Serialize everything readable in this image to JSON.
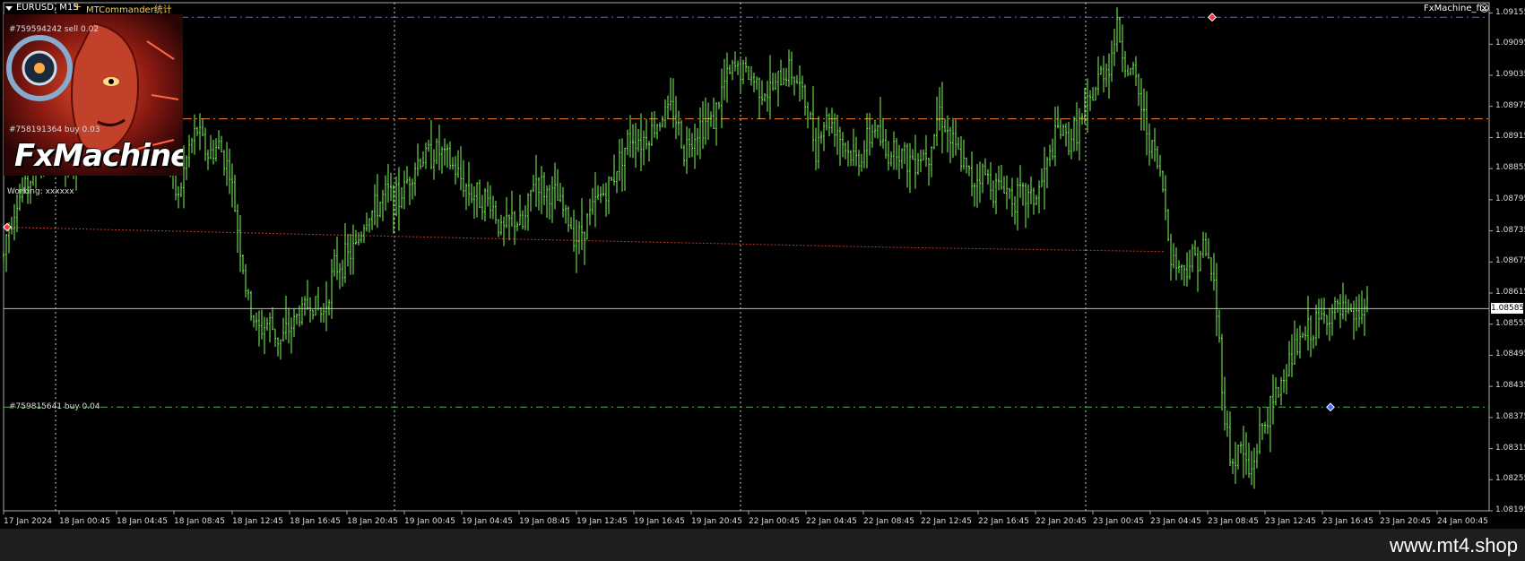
{
  "header": {
    "symbol": "EURUSD, M15",
    "plus": "+",
    "indicator": "MTCommander统计",
    "ea_name": "FxMachine_fix"
  },
  "logo": {
    "text": "FxMachine",
    "icon": "robot-head-logo"
  },
  "status": {
    "working": "Working: xxxxxx"
  },
  "orders": [
    {
      "label": "#759594242 sell 0.02",
      "price": 1.09147,
      "color": "#3f6fff"
    },
    {
      "label": "#758191364 buy 0.03",
      "price": 1.08951,
      "color": "#ff7f27"
    },
    {
      "label": "#759815641 buy 0.04",
      "price": 1.08395,
      "color": "#4caf50"
    }
  ],
  "price_axis": [
    "1.09155",
    "1.09095",
    "1.09035",
    "1.08975",
    "1.08915",
    "1.08855",
    "1.08795",
    "1.08735",
    "1.08675",
    "1.08615",
    "1.08555",
    "1.08495",
    "1.08435",
    "1.08375",
    "1.08315",
    "1.08255",
    "1.08195"
  ],
  "current_price": "1.08585",
  "time_axis": [
    "17 Jan 2024",
    "18 Jan 00:45",
    "18 Jan 04:45",
    "18 Jan 08:45",
    "18 Jan 12:45",
    "18 Jan 16:45",
    "18 Jan 20:45",
    "19 Jan 00:45",
    "19 Jan 04:45",
    "19 Jan 08:45",
    "19 Jan 12:45",
    "19 Jan 16:45",
    "19 Jan 20:45",
    "22 Jan 00:45",
    "22 Jan 04:45",
    "22 Jan 08:45",
    "22 Jan 12:45",
    "22 Jan 16:45",
    "22 Jan 20:45",
    "23 Jan 00:45",
    "23 Jan 04:45",
    "23 Jan 08:45",
    "23 Jan 12:45",
    "23 Jan 16:45",
    "23 Jan 20:45",
    "24 Jan 00:45"
  ],
  "footer": {
    "site": "www.mt4.shop"
  },
  "chart_data": {
    "type": "candlestick",
    "symbol": "EURUSD",
    "timeframe": "M15",
    "ylim": [
      1.08195,
      1.09175
    ],
    "bar_color": "#7CFC5A",
    "background": "#000000",
    "grid": "vertical dotted (day separators)",
    "close_path": [
      [
        0,
        1.0862
      ],
      [
        6,
        1.0872
      ],
      [
        18,
        1.0879
      ],
      [
        28,
        1.0882
      ],
      [
        40,
        1.0885
      ],
      [
        52,
        1.0889
      ],
      [
        62,
        1.0896
      ],
      [
        76,
        1.0884
      ],
      [
        88,
        1.0888
      ],
      [
        102,
        1.0899
      ],
      [
        118,
        1.0893
      ],
      [
        132,
        1.0897
      ],
      [
        144,
        1.0905
      ],
      [
        158,
        1.0898
      ],
      [
        170,
        1.09
      ],
      [
        180,
        1.0894
      ],
      [
        190,
        1.0887
      ],
      [
        198,
        1.0879
      ],
      [
        210,
        1.0889
      ],
      [
        220,
        1.0893
      ],
      [
        232,
        1.0888
      ],
      [
        244,
        1.089
      ],
      [
        256,
        1.0885
      ],
      [
        266,
        1.0873
      ],
      [
        276,
        1.086
      ],
      [
        288,
        1.0854
      ],
      [
        300,
        1.0856
      ],
      [
        312,
        1.0852
      ],
      [
        324,
        1.0855
      ],
      [
        336,
        1.0858
      ],
      [
        348,
        1.086
      ],
      [
        360,
        1.0857
      ],
      [
        372,
        1.0866
      ],
      [
        384,
        1.0868
      ],
      [
        396,
        1.087
      ],
      [
        408,
        1.0876
      ],
      [
        420,
        1.0878
      ],
      [
        432,
        1.0881
      ],
      [
        444,
        1.0879
      ],
      [
        456,
        1.0884
      ],
      [
        466,
        1.0887
      ],
      [
        476,
        1.0888
      ],
      [
        488,
        1.0889
      ],
      [
        500,
        1.0887
      ],
      [
        512,
        1.0884
      ],
      [
        524,
        1.0881
      ],
      [
        536,
        1.088
      ],
      [
        548,
        1.0879
      ],
      [
        560,
        1.0873
      ],
      [
        572,
        1.0876
      ],
      [
        584,
        1.0874
      ],
      [
        596,
        1.0884
      ],
      [
        608,
        1.0881
      ],
      [
        620,
        1.088
      ],
      [
        632,
        1.0876
      ],
      [
        644,
        1.0872
      ],
      [
        656,
        1.0876
      ],
      [
        668,
        1.088
      ],
      [
        680,
        1.0882
      ],
      [
        692,
        1.0888
      ],
      [
        704,
        1.0892
      ],
      [
        716,
        1.0891
      ],
      [
        728,
        1.0893
      ],
      [
        740,
        1.0896
      ],
      [
        752,
        1.0897
      ],
      [
        762,
        1.0889
      ],
      [
        772,
        1.0892
      ],
      [
        782,
        1.0894
      ],
      [
        796,
        1.0895
      ],
      [
        808,
        1.0902
      ],
      [
        820,
        1.0905
      ],
      [
        832,
        1.0904
      ],
      [
        844,
        1.0902
      ],
      [
        856,
        1.09
      ],
      [
        868,
        1.0902
      ],
      [
        880,
        1.0905
      ],
      [
        890,
        1.0902
      ],
      [
        900,
        1.0897
      ],
      [
        910,
        1.089
      ],
      [
        920,
        1.0895
      ],
      [
        932,
        1.0894
      ],
      [
        944,
        1.0889
      ],
      [
        956,
        1.0887
      ],
      [
        966,
        1.089
      ],
      [
        976,
        1.0894
      ],
      [
        988,
        1.0888
      ],
      [
        1000,
        1.089
      ],
      [
        1012,
        1.0887
      ],
      [
        1024,
        1.0888
      ],
      [
        1036,
        1.0889
      ],
      [
        1048,
        1.0897
      ],
      [
        1060,
        1.0891
      ],
      [
        1072,
        1.0887
      ],
      [
        1084,
        1.0883
      ],
      [
        1096,
        1.0885
      ],
      [
        1108,
        1.0882
      ],
      [
        1120,
        1.0882
      ],
      [
        1132,
        1.088
      ],
      [
        1144,
        1.088
      ],
      [
        1156,
        1.088
      ],
      [
        1168,
        1.0886
      ],
      [
        1180,
        1.0893
      ],
      [
        1192,
        1.0891
      ],
      [
        1204,
        1.0894
      ],
      [
        1216,
        1.0898
      ],
      [
        1228,
        1.0904
      ],
      [
        1238,
        1.0906
      ],
      [
        1246,
        1.0913
      ],
      [
        1256,
        1.0905
      ],
      [
        1266,
        1.0903
      ],
      [
        1276,
        1.0895
      ],
      [
        1286,
        1.0889
      ],
      [
        1296,
        1.0883
      ],
      [
        1306,
        1.0869
      ],
      [
        1318,
        1.0866
      ],
      [
        1330,
        1.0868
      ],
      [
        1342,
        1.087
      ],
      [
        1352,
        1.0866
      ],
      [
        1358,
        1.0856
      ],
      [
        1366,
        1.0838
      ],
      [
        1374,
        1.0828
      ],
      [
        1384,
        1.0832
      ],
      [
        1394,
        1.0826
      ],
      [
        1406,
        1.0835
      ],
      [
        1418,
        1.0839
      ],
      [
        1430,
        1.0845
      ],
      [
        1442,
        1.085
      ],
      [
        1454,
        1.0853
      ],
      [
        1466,
        1.0855
      ],
      [
        1478,
        1.0857
      ],
      [
        1490,
        1.0858
      ],
      [
        1502,
        1.0857
      ],
      [
        1514,
        1.0857
      ],
      [
        1526,
        1.0859
      ]
    ]
  }
}
